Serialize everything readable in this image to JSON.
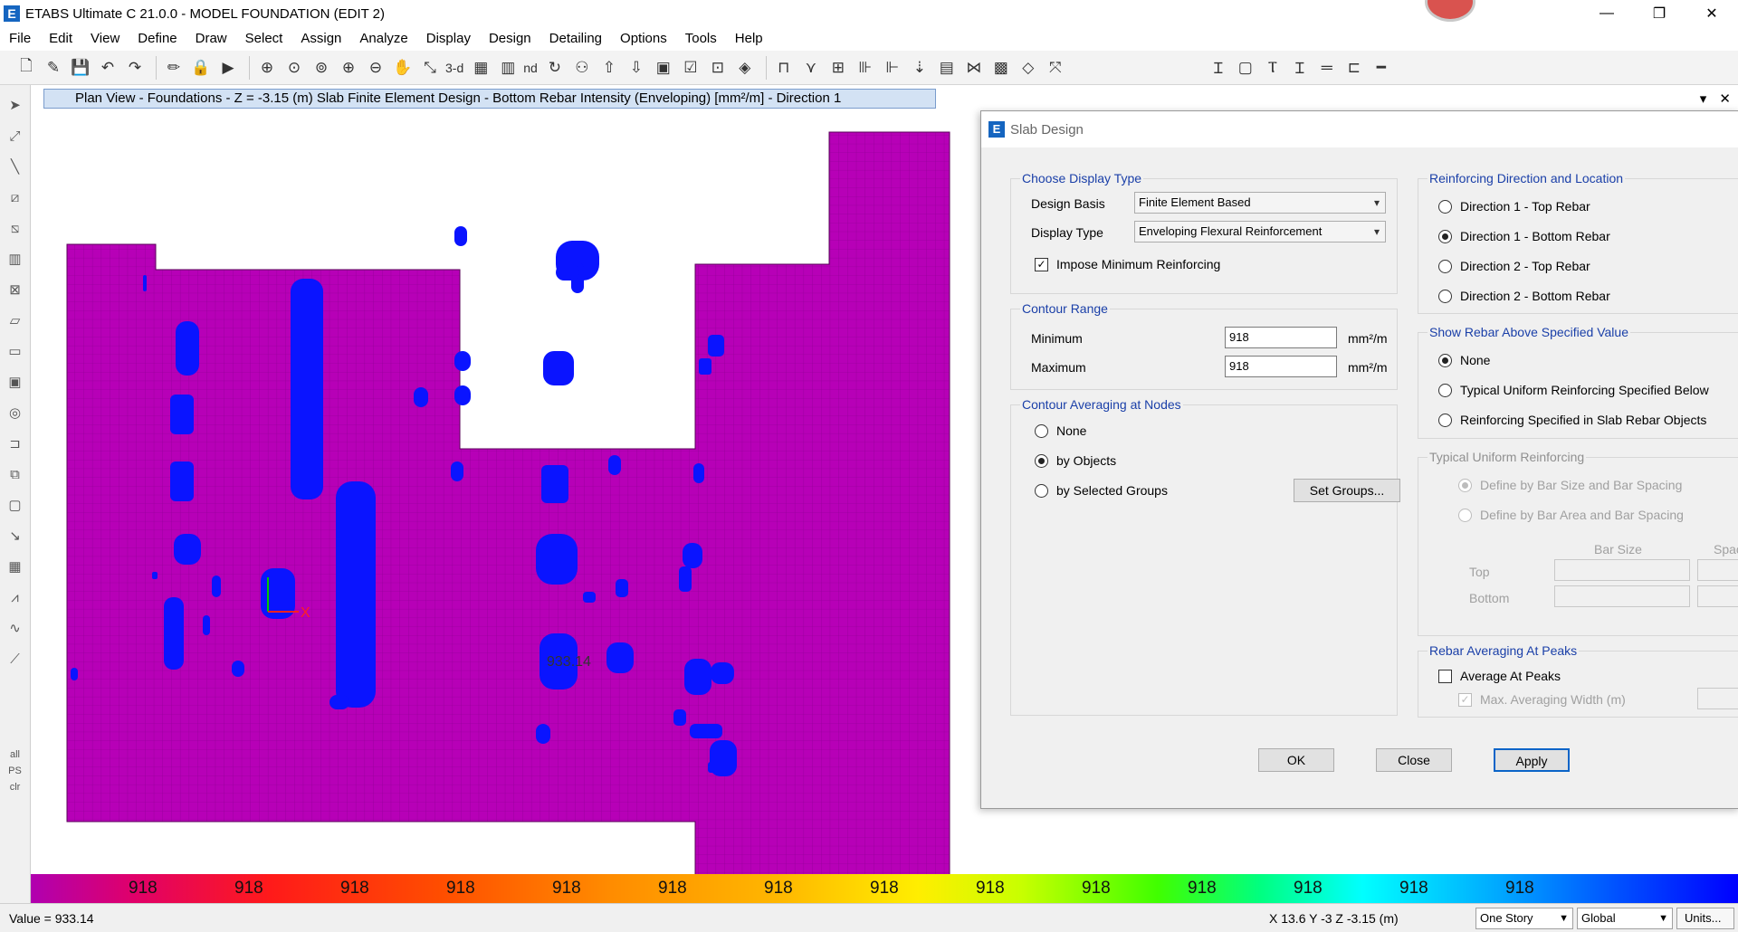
{
  "window": {
    "title": "ETABS Ultimate C 21.0.0 - MODEL FOUNDATION (EDIT 2)",
    "app_icon_letter": "E",
    "minimize": "—",
    "restore": "❐",
    "close": "✕"
  },
  "menu": [
    "File",
    "Edit",
    "View",
    "Define",
    "Draw",
    "Select",
    "Assign",
    "Analyze",
    "Display",
    "Design",
    "Detailing",
    "Options",
    "Tools",
    "Help"
  ],
  "toolbar": {
    "view_3d_label": "3-d",
    "nd_label": "nd"
  },
  "left_tools": {
    "all_label": "all",
    "ps_label": "PS",
    "clr_label": "clr"
  },
  "plan_view": {
    "tab_title": "Plan View - Foundations - Z = -3.15 (m)  Slab Finite Element Design - Bottom Rebar Intensity (Enveloping) [mm²/m] - Direction 1",
    "tab_dropdown": "▾",
    "tab_close": "✕",
    "slab_color": "#b700b7",
    "rebar_color": "#0a14ff",
    "axis_x_label": "X",
    "value_label": "933.14"
  },
  "legend": {
    "values": [
      "918",
      "918",
      "918",
      "918",
      "918",
      "918",
      "918",
      "918",
      "918",
      "918",
      "918",
      "918",
      "918",
      "918"
    ]
  },
  "status": {
    "value_text": "Value = 933.14",
    "coords": "X 13.6  Y -3  Z -3.15 (m)",
    "story_select": "One Story",
    "coord_select": "Global",
    "units_button": "Units..."
  },
  "dialog": {
    "title": "Slab Design",
    "icon_letter": "E",
    "display_type_group": {
      "label": "Choose Display Type",
      "design_basis_label": "Design Basis",
      "design_basis_value": "Finite Element Based",
      "display_type_label": "Display Type",
      "display_type_value": "Enveloping Flexural Reinforcement",
      "impose_min_label": "Impose Minimum Reinforcing"
    },
    "contour_range_group": {
      "label": "Contour Range",
      "minimum_label": "Minimum",
      "minimum_value": "918",
      "maximum_label": "Maximum",
      "maximum_value": "918",
      "unit": "mm²/m"
    },
    "averaging_group": {
      "label": "Contour Averaging at Nodes",
      "none_label": "None",
      "by_objects_label": "by Objects",
      "by_groups_label": "by Selected Groups",
      "set_groups_button": "Set Groups..."
    },
    "direction_group": {
      "label": "Reinforcing Direction and Location",
      "options": [
        "Direction 1  -  Top Rebar",
        "Direction 1  -  Bottom Rebar",
        "Direction 2  -  Top Rebar",
        "Direction 2  -  Bottom Rebar"
      ]
    },
    "show_rebar_group": {
      "label": "Show Rebar Above Specified Value",
      "options": [
        "None",
        "Typical Uniform Reinforcing Specified Below",
        "Reinforcing Specified in Slab Rebar Objects"
      ]
    },
    "typical_uniform_group": {
      "label": "Typical Uniform Reinforcing",
      "bar_size_spacing_label": "Define by Bar Size and Bar Spacing",
      "bar_area_spacing_label": "Define by Bar Area and Bar Spacing",
      "bar_size_header": "Bar Size",
      "spacing_header": "Spaci",
      "top_label": "Top",
      "bottom_label": "Bottom"
    },
    "rebar_averaging_group": {
      "label": "Rebar Averaging At Peaks",
      "average_label": "Average At Peaks",
      "max_width_label": "Max. Averaging Width  (m)"
    },
    "ok_button": "OK",
    "close_button": "Close",
    "apply_button": "Apply"
  }
}
